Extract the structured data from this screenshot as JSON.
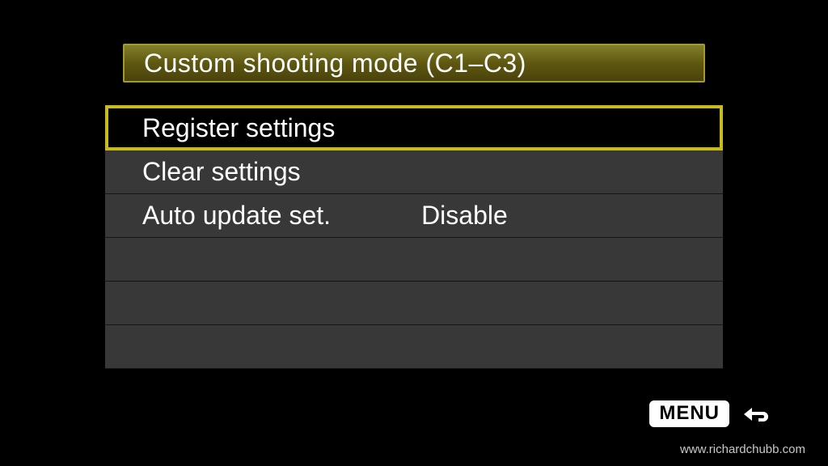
{
  "title": "Custom shooting mode (C1–C3)",
  "menu": {
    "items": [
      {
        "label": "Register settings",
        "value": "",
        "selected": true
      },
      {
        "label": "Clear settings",
        "value": "",
        "selected": false
      },
      {
        "label": "Auto update set.",
        "value": "Disable",
        "selected": false
      },
      {
        "label": "",
        "value": "",
        "selected": false
      },
      {
        "label": "",
        "value": "",
        "selected": false
      },
      {
        "label": "",
        "value": "",
        "selected": false
      }
    ]
  },
  "footer": {
    "menu_label": "MENU"
  },
  "watermark": "www.richardchubb.com"
}
